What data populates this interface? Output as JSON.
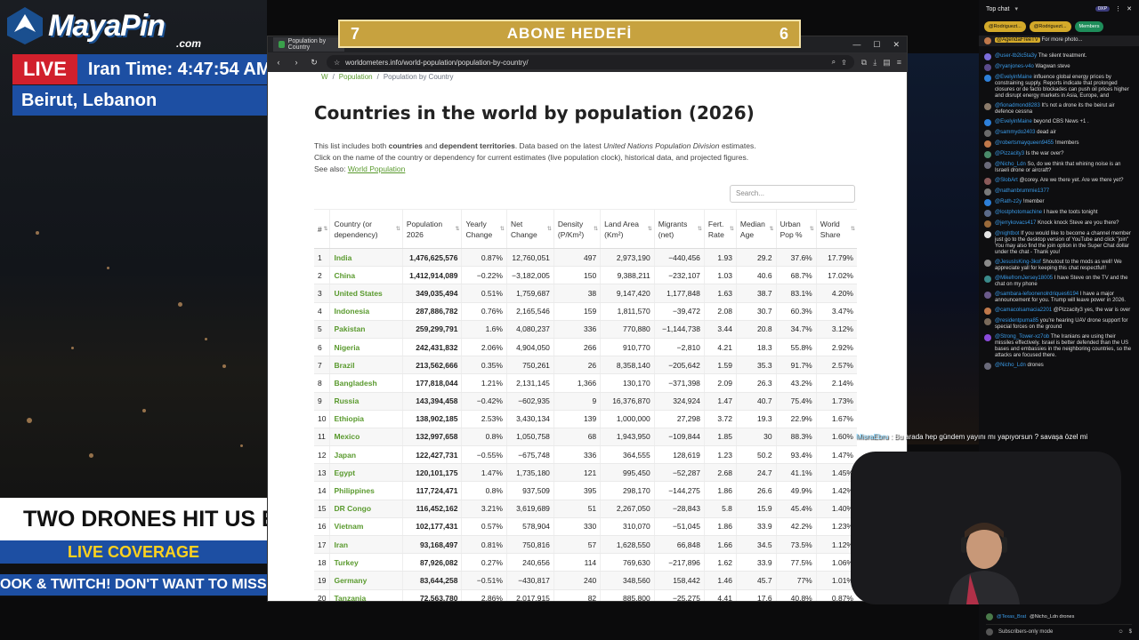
{
  "news": {
    "brand": "MayaPin",
    "brand_suffix": ".com",
    "live_label": "LIVE",
    "time_text": "Iran Time: 4:47:54 AM",
    "location": "Beirut, Lebanon",
    "headline": "TWO DRONES HIT US E",
    "coverage": "LIVE COVERAGE",
    "ticker": "OOK & TWITCH!    DON'T WANT TO MISS"
  },
  "goal": {
    "left_num": "7",
    "title": "ABONE HEDEFİ",
    "right_num": "6"
  },
  "browser": {
    "tab_title": "Population by Country",
    "url": "worldometers.info/world-population/population-by-country/"
  },
  "page": {
    "crumbs": [
      "W",
      "Population",
      "Population by Country"
    ],
    "title": "Countries in the world by population (2026)",
    "intro1_a": "This list includes both ",
    "intro1_b": "countries",
    "intro1_c": " and ",
    "intro1_d": "dependent territories",
    "intro1_e": ". Data based on the latest ",
    "intro1_f": "United Nations Population Division",
    "intro1_g": " estimates.",
    "intro2": "Click on the name of the country or dependency for current estimates (live population clock), historical data, and projected figures.",
    "see_also_label": "See also: ",
    "see_also_link": "World Population",
    "search_placeholder": "Search..."
  },
  "table": {
    "headers": [
      "#",
      "Country (or dependency)",
      "Population 2026",
      "Yearly Change",
      "Net Change",
      "Density (P/Km²)",
      "Land Area (Km²)",
      "Migrants (net)",
      "Fert. Rate",
      "Median Age",
      "Urban Pop %",
      "World Share"
    ],
    "rows": [
      [
        "1",
        "India",
        "1,476,625,576",
        "0.87%",
        "12,760,051",
        "497",
        "2,973,190",
        "−440,456",
        "1.93",
        "29.2",
        "37.6%",
        "17.79%"
      ],
      [
        "2",
        "China",
        "1,412,914,089",
        "−0.22%",
        "−3,182,005",
        "150",
        "9,388,211",
        "−232,107",
        "1.03",
        "40.6",
        "68.7%",
        "17.02%"
      ],
      [
        "3",
        "United States",
        "349,035,494",
        "0.51%",
        "1,759,687",
        "38",
        "9,147,420",
        "1,177,848",
        "1.63",
        "38.7",
        "83.1%",
        "4.20%"
      ],
      [
        "4",
        "Indonesia",
        "287,886,782",
        "0.76%",
        "2,165,546",
        "159",
        "1,811,570",
        "−39,472",
        "2.08",
        "30.7",
        "60.3%",
        "3.47%"
      ],
      [
        "5",
        "Pakistan",
        "259,299,791",
        "1.6%",
        "4,080,237",
        "336",
        "770,880",
        "−1,144,738",
        "3.44",
        "20.8",
        "34.7%",
        "3.12%"
      ],
      [
        "6",
        "Nigeria",
        "242,431,832",
        "2.06%",
        "4,904,050",
        "266",
        "910,770",
        "−2,810",
        "4.21",
        "18.3",
        "55.8%",
        "2.92%"
      ],
      [
        "7",
        "Brazil",
        "213,562,666",
        "0.35%",
        "750,261",
        "26",
        "8,358,140",
        "−205,642",
        "1.59",
        "35.3",
        "91.7%",
        "2.57%"
      ],
      [
        "8",
        "Bangladesh",
        "177,818,044",
        "1.21%",
        "2,131,145",
        "1,366",
        "130,170",
        "−371,398",
        "2.09",
        "26.3",
        "43.2%",
        "2.14%"
      ],
      [
        "9",
        "Russia",
        "143,394,458",
        "−0.42%",
        "−602,935",
        "9",
        "16,376,870",
        "324,924",
        "1.47",
        "40.7",
        "75.4%",
        "1.73%"
      ],
      [
        "10",
        "Ethiopia",
        "138,902,185",
        "2.53%",
        "3,430,134",
        "139",
        "1,000,000",
        "27,298",
        "3.72",
        "19.3",
        "22.9%",
        "1.67%"
      ],
      [
        "11",
        "Mexico",
        "132,997,658",
        "0.8%",
        "1,050,758",
        "68",
        "1,943,950",
        "−109,844",
        "1.85",
        "30",
        "88.3%",
        "1.60%"
      ],
      [
        "12",
        "Japan",
        "122,427,731",
        "−0.55%",
        "−675,748",
        "336",
        "364,555",
        "128,619",
        "1.23",
        "50.2",
        "93.4%",
        "1.47%"
      ],
      [
        "13",
        "Egypt",
        "120,101,175",
        "1.47%",
        "1,735,180",
        "121",
        "995,450",
        "−52,287",
        "2.68",
        "24.7",
        "41.1%",
        "1.45%"
      ],
      [
        "14",
        "Philippines",
        "117,724,471",
        "0.8%",
        "937,509",
        "395",
        "298,170",
        "−144,275",
        "1.86",
        "26.6",
        "49.9%",
        "1.42%"
      ],
      [
        "15",
        "DR Congo",
        "116,452,162",
        "3.21%",
        "3,619,689",
        "51",
        "2,267,050",
        "−28,843",
        "5.8",
        "15.9",
        "45.4%",
        "1.40%"
      ],
      [
        "16",
        "Vietnam",
        "102,177,431",
        "0.57%",
        "578,904",
        "330",
        "310,070",
        "−51,045",
        "1.86",
        "33.9",
        "42.2%",
        "1.23%"
      ],
      [
        "17",
        "Iran",
        "93,168,497",
        "0.81%",
        "750,816",
        "57",
        "1,628,550",
        "66,848",
        "1.66",
        "34.5",
        "73.5%",
        "1.12%"
      ],
      [
        "18",
        "Turkey",
        "87,926,082",
        "0.27%",
        "240,656",
        "114",
        "769,630",
        "−217,896",
        "1.62",
        "33.9",
        "77.5%",
        "1.06%"
      ],
      [
        "19",
        "Germany",
        "83,644,258",
        "−0.51%",
        "−430,817",
        "240",
        "348,560",
        "158,442",
        "1.46",
        "45.7",
        "77%",
        "1.01%"
      ],
      [
        "20",
        "Tanzania",
        "72,563,780",
        "2.86%",
        "2,017,915",
        "82",
        "885,800",
        "−25,275",
        "4.41",
        "17.6",
        "40.8%",
        "0.87%"
      ]
    ]
  },
  "chat": {
    "header": "Top chat",
    "badge": "0XP",
    "pins": [
      "@Rodriguezt...",
      "@Rodriguezt...",
      "Members"
    ],
    "pinned_user": "@AgendaFreeTV",
    "pinned_more": "For more photo...",
    "messages": [
      {
        "user": "@user-tb2lc5ta3y",
        "text": "The silent treatment.",
        "color": "#7b6cd9"
      },
      {
        "user": "@ryanjones-v4o",
        "text": "Wagwan steve",
        "color": "#5a4a8a"
      },
      {
        "user": "@EvelyinMaine",
        "text": "influence global energy prices by constraining supply. Reports indicate that prolonged closures or de facto blockades can push oil prices higher and disrupt energy markets in Asia, Europe, and",
        "color": "#2d7fd9"
      },
      {
        "user": "@fionadmond8283",
        "text": "It's not a drone its the beirut air defence cessna",
        "color": "#8a7a6a"
      },
      {
        "user": "@EvelyinMaine",
        "text": "beyond CBS News +1 .",
        "color": "#2d7fd9"
      },
      {
        "user": "@sammydo2403",
        "text": "dead air",
        "color": "#6a6a6a"
      },
      {
        "user": "@robertsmayqueen9455",
        "text": "!members",
        "color": "#c0784a"
      },
      {
        "user": "@Pizzacity3",
        "text": "Is the war over?",
        "color": "#4a8a6a"
      },
      {
        "user": "@Nicho_Ldn",
        "text": "So, do we think that whining noise is an Israeli drone or aircraft?",
        "color": "#6a6a7a"
      },
      {
        "user": "@SlobArt",
        "text": "@corey. Are we there yet. Are we there yet?",
        "color": "#8a5a5a"
      },
      {
        "user": "@nathanbrummie1377",
        "text": "",
        "color": "#7a7a7a"
      },
      {
        "user": "@Rath-z2y",
        "text": "!member",
        "color": "#2d7fd9"
      },
      {
        "user": "@lostphotomachine",
        "text": "I have the toots tonight",
        "color": "#5a6a8a"
      },
      {
        "user": "@jerrykovacs417",
        "text": "Knock knock   Steve are you there?",
        "color": "#9a6a3a"
      },
      {
        "user": "@nightbot",
        "text": "If you would like to become a channel member just go to the desktop version of YouTube and click \"join\" You may also find the join option in the Super Chat dollar under the chat - Thank you!",
        "color": "#e5e5e5"
      },
      {
        "user": "@JesusIsKing-3kof",
        "text": "Shoutout to the mods as well! We appreciate yall for keeping this chat respectful!!",
        "color": "#8a8a8a"
      },
      {
        "user": "@MikefromJersey18005",
        "text": "I have Steve on the TV and the chat on my phone",
        "color": "#3a8a8a"
      },
      {
        "user": "@sambara-lefoonenolrdriques6194",
        "text": "I have a major announcement for you. Trump will leave power in 2026.",
        "color": "#6a5a8a"
      },
      {
        "user": "@camacolsamacia2201",
        "text": "@Pizzacity3 yes, the war is over",
        "color": "#c0784a"
      },
      {
        "user": "@residentpuma85",
        "text": "you're hearing UAV drone support for special forces on the ground",
        "color": "#7a6a5a"
      },
      {
        "user": "@Strong_Tower-xz7ob",
        "text": "The Iranians are using their missiles effectively. Israel is better defended than the US bases and embassies in the neighboring countries, so the attacks are focused there.",
        "color": "#8a4ad9"
      },
      {
        "user": "@Nicho_Ldn",
        "text": "drones",
        "color": "#6a6a7a"
      }
    ],
    "last_user": "@Texas_Brat",
    "last_text": "@Nicho_Ldn drones",
    "mode": "Subscribers-only mode"
  },
  "overlay": {
    "name": "MisraEbru",
    "text": "Bu arada hep gündem yayını mı yapıyorsun ? savaşa özel mi"
  }
}
